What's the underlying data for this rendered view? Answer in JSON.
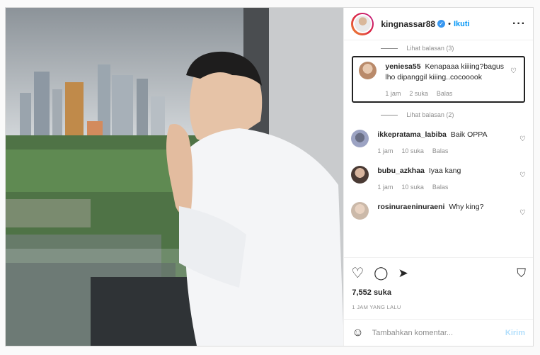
{
  "post": {
    "username": "kingnassar88",
    "verified_icon": "verified-badge-icon",
    "separator": "•",
    "follow_label": "Ikuti",
    "more_icon": "more-options-icon"
  },
  "comments": [
    {
      "type": "replies",
      "label": "Lihat balasan (3)"
    },
    {
      "type": "comment",
      "user": "yeniesa55",
      "text": "Kenapaaa kiiiing?bagus lho dipanggil kiiing..cocooook",
      "time": "1 jam",
      "likes": "2 suka",
      "reply": "Balas",
      "selected": true
    },
    {
      "type": "replies",
      "label": "Lihat balasan (2)"
    },
    {
      "type": "comment",
      "user": "ikkepratama_labiba",
      "text": "Baik OPPA",
      "time": "1 jam",
      "likes": "10 suka",
      "reply": "Balas"
    },
    {
      "type": "comment",
      "user": "bubu_azkhaa",
      "text": "Iyaa kang",
      "time": "1 jam",
      "likes": "10 suka",
      "reply": "Balas"
    },
    {
      "type": "comment",
      "user": "rosinuraeninuraeni",
      "text": "Why king?",
      "time": "",
      "likes": "",
      "reply": ""
    }
  ],
  "footer": {
    "likes": "7,552 suka",
    "timestamp": "1 JAM YANG LALU",
    "comment_placeholder": "Tambahkan komentar...",
    "post_label": "Kirim"
  },
  "colors": {
    "accent": "#0095f6",
    "muted": "#8e8e8e"
  }
}
